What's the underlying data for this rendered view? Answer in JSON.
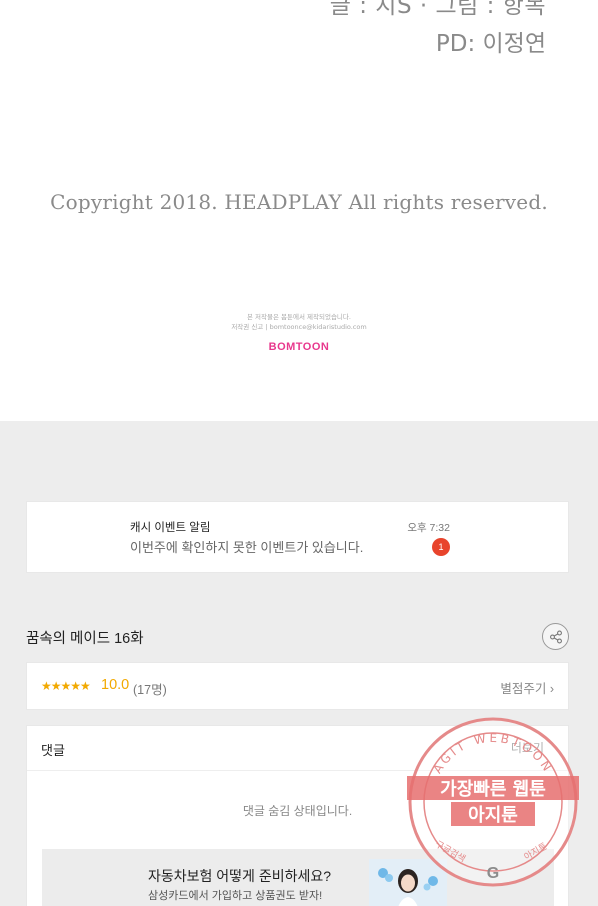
{
  "credits": {
    "line1": "글 : 지S · 그림 : 항목",
    "line2": "PD: 이정연",
    "copyright": "Copyright 2018. HEADPLAY All rights reserved.",
    "fine_print_line1": "본 저작물은 봄툰에서 제작되었습니다.",
    "fine_print_line2": "저작권 신고 | bomtoonce@kidaristudio.com",
    "logo_text": "BOMTOON"
  },
  "notice": {
    "title": "캐시 이벤트 알림",
    "body": "이번주에 확인하지 못한 이벤트가 있습니다.",
    "time": "오후 7:32",
    "badge_count": "1"
  },
  "episode": {
    "title": "꿈속의 메이드 16화",
    "share_icon": "share-icon"
  },
  "rating": {
    "stars": "★★★★★",
    "star_value": 5,
    "score": "10.0",
    "count": "(17명)",
    "rate_link": "별점주기 ›"
  },
  "comments": {
    "title": "댓글",
    "more_link": "더보기",
    "hidden_message": "댓글 숨김 상태입니다."
  },
  "ad": {
    "title": "자동차보험 어떻게 준비하세요?",
    "subtitle": "삼성카드에서 가입하고 상품권도 받자!"
  },
  "watermark": {
    "ring_text": "AGIT WEBTOON",
    "line1": "가장빠른 웹툰",
    "line2": "아지툰",
    "bottom_left": "구글검색",
    "bottom_right": "아지툰",
    "center_letter": "G"
  },
  "colors": {
    "brand_pink": "#e8388d",
    "star_gold": "#f2a900",
    "badge_red": "#e8442c",
    "watermark_red": "#e06060"
  }
}
